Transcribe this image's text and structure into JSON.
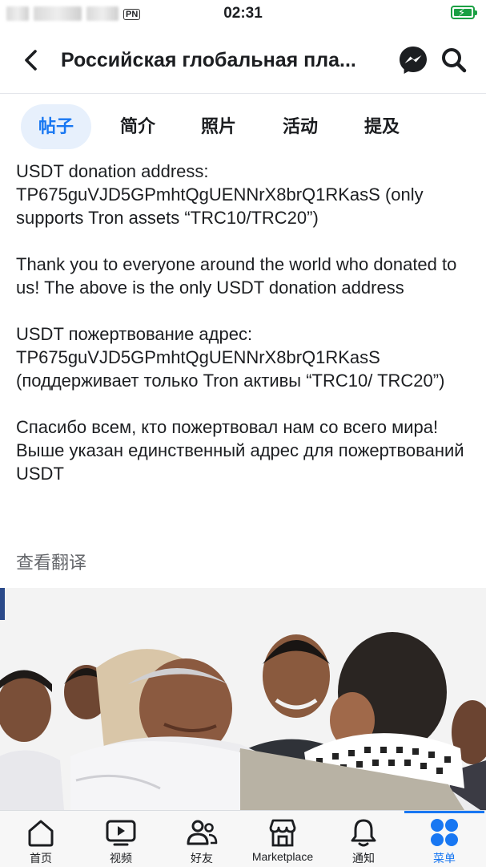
{
  "status_bar": {
    "vpn": "PN",
    "time": "02:31"
  },
  "header": {
    "title": "Российская глобальная пла..."
  },
  "tabs": [
    {
      "label": "帖子"
    },
    {
      "label": "简介"
    },
    {
      "label": "照片"
    },
    {
      "label": "活动"
    },
    {
      "label": "提及"
    }
  ],
  "post": {
    "paragraphs": [
      "USDT donation address:\nTP675guVJD5GPmhtQgUENNrX8brQ1RKasS (only supports Tron assets “TRC10/TRC20”)",
      "Thank you to everyone around the world who donated to us! The above is the only USDT donation address",
      "USDT пожертвование адрес:\nTP675guVJD5GPmhtQgUENNrX8brQ1RKasS (поддерживает только Tron активы “TRC10/ TRC20”)",
      "Спасибо всем, кто пожертвовал нам со всего мира! Выше указан единственный адрес для пожертвований USDT"
    ],
    "see_translation": "查看翻译"
  },
  "bottom_nav": [
    {
      "label": "首页",
      "icon": "home-icon"
    },
    {
      "label": "视频",
      "icon": "video-icon"
    },
    {
      "label": "好友",
      "icon": "friends-icon"
    },
    {
      "label": "Marketplace",
      "icon": "marketplace-icon"
    },
    {
      "label": "通知",
      "icon": "bell-icon"
    },
    {
      "label": "菜单",
      "icon": "menu-icon"
    }
  ],
  "colors": {
    "accent": "#1877f2",
    "battery": "#1aa043"
  }
}
